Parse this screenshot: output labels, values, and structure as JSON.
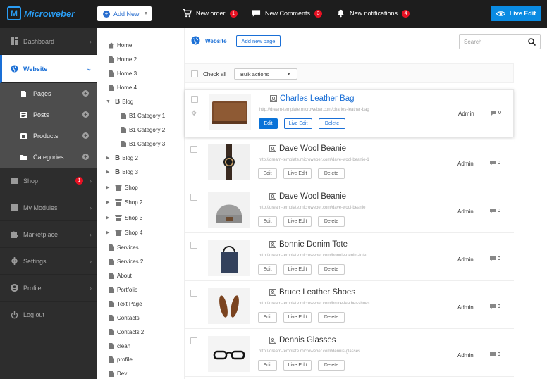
{
  "topbar": {
    "logo": "Microweber",
    "add_new": "Add New",
    "new_order": {
      "label": "New order",
      "count": "1"
    },
    "new_comments": {
      "label": "New Comments",
      "count": "3"
    },
    "new_notifications": {
      "label": "New notifications",
      "count": "4"
    },
    "live_edit": "Live Edit",
    "accent": "#0a8be2",
    "badge_color": "#e81123"
  },
  "sidebar": {
    "dashboard": "Dashboard",
    "website": "Website",
    "subitems": [
      "Pages",
      "Posts",
      "Products",
      "Categories"
    ],
    "shop": {
      "label": "Shop",
      "badge": "1"
    },
    "modules": "My Modules",
    "marketplace": "Marketplace",
    "settings": "Settings",
    "profile": "Profile",
    "logout": "Log out"
  },
  "tree": {
    "items": [
      "Home",
      "Home 2",
      "Home 3",
      "Home 4",
      "Blog",
      "B1 Category 1",
      "B1 Category 2",
      "B1 Category 3",
      "Blog 2",
      "Blog 3",
      "Shop",
      "Shop 2",
      "Shop 3",
      "Shop 4",
      "Services",
      "Services 2",
      "About",
      "Portfolio",
      "Text Page",
      "Contacts",
      "Contacts 2",
      "clean",
      "profile",
      "Dev"
    ]
  },
  "main": {
    "title": "Website",
    "add_new_page": "Add new page",
    "search_placeholder": "Search",
    "check_all": "Check all",
    "bulk_actions": "Bulk actions",
    "btn_edit": "Edit",
    "btn_live_edit": "Live Edit",
    "btn_delete": "Delete"
  },
  "products": [
    {
      "title": "Charles Leather Bag",
      "url": "http://dream-template.microweber.com/charles-leather-bag",
      "author": "Admin",
      "comments": "0",
      "image": "leather-bag"
    },
    {
      "title": "Dave Wool Beanie",
      "url": "http://dream-template.microweber.com/dave-wool-beanie-1",
      "author": "Admin",
      "comments": "0",
      "image": "watch"
    },
    {
      "title": "Dave Wool Beanie",
      "url": "http://dream-template.microweber.com/dave-wool-beanie",
      "author": "Admin",
      "comments": "0",
      "image": "beanie"
    },
    {
      "title": "Bonnie Denim Tote",
      "url": "http://dream-template.microweber.com/bonnie-denim-tote",
      "author": "Admin",
      "comments": "0",
      "image": "tote"
    },
    {
      "title": "Bruce Leather Shoes",
      "url": "http://dream-template.microweber.com/bruce-leather-shoes",
      "author": "Admin",
      "comments": "0",
      "image": "shoes"
    },
    {
      "title": "Dennis Glasses",
      "url": "http://dream-template.microweber.com/dennis-glasses",
      "author": "Admin",
      "comments": "0",
      "image": "glasses"
    }
  ]
}
